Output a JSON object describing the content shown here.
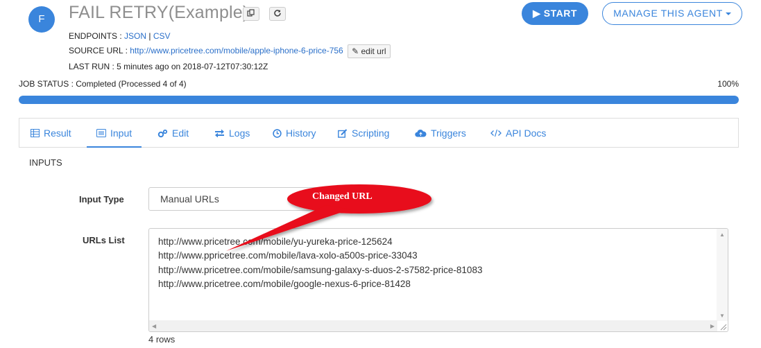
{
  "header": {
    "avatar_letter": "F",
    "title": "FAIL RETRY(Example)",
    "endpoints_label": "ENDPOINTS :",
    "endpoint_json": "JSON",
    "endpoint_sep": "|",
    "endpoint_csv": "CSV",
    "source_url_label": "SOURCE URL :",
    "source_url": "http://www.pricetree.com/mobile/apple-iphone-6-price-756",
    "edit_url_label": "edit url",
    "last_run": "LAST RUN : 5 minutes ago on 2018-07-12T07:30:12Z",
    "start_label": "START",
    "manage_label": "MANAGE THIS AGENT"
  },
  "job": {
    "status_text": "JOB STATUS : Completed (Processed 4 of 4)",
    "percent_label": "100%",
    "progress": 1.0
  },
  "tabs": [
    {
      "label": "Result",
      "icon": "table-icon"
    },
    {
      "label": "Input",
      "icon": "list-icon",
      "active": true
    },
    {
      "label": "Edit",
      "icon": "gears-icon"
    },
    {
      "label": "Logs",
      "icon": "exchange-icon"
    },
    {
      "label": "History",
      "icon": "clock-icon"
    },
    {
      "label": "Scripting",
      "icon": "edit-icon"
    },
    {
      "label": "Triggers",
      "icon": "cloud-upload-icon"
    },
    {
      "label": "API Docs",
      "icon": "code-icon"
    }
  ],
  "inputs": {
    "section_title": "INPUTS",
    "input_type_label": "Input Type",
    "input_type_value": "Manual URLs",
    "urls_label": "URLs List",
    "urls": [
      "http://www.pricetree.com/mobile/yu-yureka-price-125624",
      "http://www.ppricetree.com/mobile/lava-xolo-a500s-price-33043",
      "http://www.pricetree.com/mobile/samsung-galaxy-s-duos-2-s7582-price-81083",
      "http://www.pricetree.com/mobile/google-nexus-6-price-81428"
    ],
    "rows_label": "4 rows"
  },
  "annotation": {
    "text": "Changed URL",
    "color": "#e8101a"
  },
  "colors": {
    "accent": "#3a85dc"
  }
}
